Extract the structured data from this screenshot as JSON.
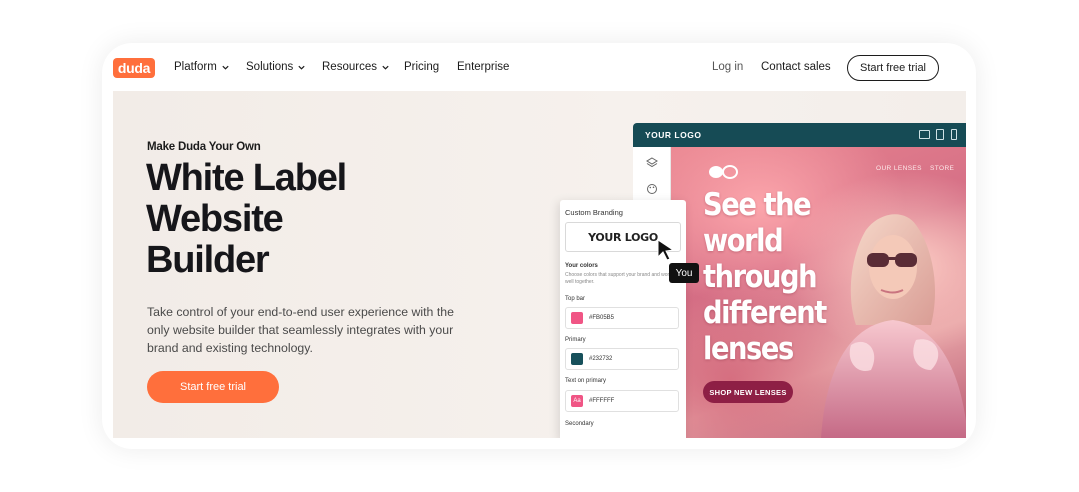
{
  "nav": {
    "brand": "duda",
    "items": [
      {
        "label": "Platform",
        "dropdown": true
      },
      {
        "label": "Solutions",
        "dropdown": true
      },
      {
        "label": "Resources",
        "dropdown": true
      },
      {
        "label": "Pricing",
        "dropdown": false
      },
      {
        "label": "Enterprise",
        "dropdown": false
      }
    ],
    "login": "Log in",
    "contact": "Contact sales",
    "trial": "Start free trial"
  },
  "hero": {
    "eyebrow": "Make Duda Your Own",
    "headline": [
      "White Label",
      "Website",
      "Builder"
    ],
    "description": "Take control of your end-to-end user experience with the only website builder that seamlessly integrates with your brand and existing technology.",
    "cta": "Start free trial"
  },
  "site": {
    "logo": "YOUR LOGO",
    "nav": [
      "OUR LENSES",
      "STORE"
    ],
    "headline": [
      "See the",
      "world",
      "through",
      "different",
      "lenses"
    ],
    "shop": "SHOP NEW LENSES",
    "devices": [
      "desktop-icon",
      "tablet-icon",
      "mobile-icon"
    ]
  },
  "branding": {
    "title": "Custom Branding",
    "logo": "YOUR LOGO",
    "colors_title": "Your colors",
    "colors_desc": "Choose colors that support your brand and work well together.",
    "rows": [
      {
        "label": "Top bar",
        "value": "#FB05B5",
        "color": "#f05585"
      },
      {
        "label": "Primary",
        "value": "#232732",
        "color": "#17505b"
      },
      {
        "label": "Text on primary",
        "value": "#FFFFFF",
        "color": "#f05585",
        "glyph": "Aa"
      }
    ],
    "last_label": "Secondary"
  },
  "cursor_tag": "You",
  "colors": {
    "accent": "#ff6f3c",
    "dark": "#164b55",
    "shop": "#8e1f45"
  }
}
